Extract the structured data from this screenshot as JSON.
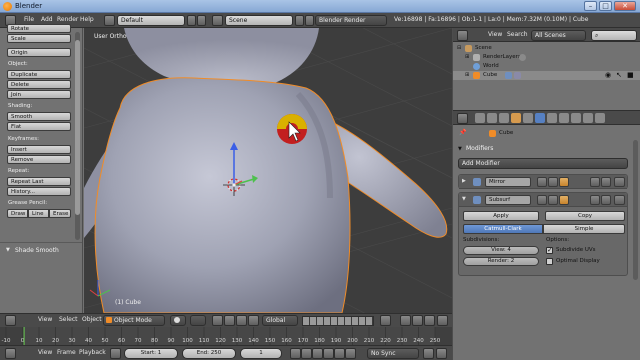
{
  "window": {
    "title": "Blender",
    "minimize": "–",
    "maximize": "□",
    "close": "✕"
  },
  "info_header": {
    "menus": [
      "File",
      "Add",
      "Render",
      "Help"
    ],
    "screen_layout": "Default",
    "scene": "Scene",
    "render_engine": "Blender Render",
    "stats": "Ve:16898 | Fa:16896 | Ob:1-1 | La:0 | Mem:7.32M (0.10M) | Cube"
  },
  "toolshelf": {
    "top_items": [
      "Rotate",
      "Scale"
    ],
    "origin": "Origin",
    "object_label": "Object:",
    "object_items": [
      "Duplicate",
      "Delete",
      "Join"
    ],
    "shading_label": "Shading:",
    "shading_items": [
      "Smooth",
      "Flat"
    ],
    "keyframes_label": "Keyframes:",
    "keyframe_items": [
      "Insert",
      "Remove"
    ],
    "repeat_label": "Repeat:",
    "repeat_items": [
      "Repeat Last",
      "History..."
    ],
    "grease_label": "Grease Pencil:",
    "grease_items": [
      "Draw",
      "Line",
      "Erase"
    ],
    "operator_panel": "Shade Smooth"
  },
  "viewport": {
    "view_label": "User Ortho",
    "object_label": "(1) Cube"
  },
  "viewport_header": {
    "menus": [
      "View",
      "Select",
      "Object"
    ],
    "mode": "Object Mode",
    "orientation": "Global"
  },
  "timeline": {
    "ticks": [
      "-10",
      "0",
      "10",
      "20",
      "30",
      "40",
      "50",
      "60",
      "70",
      "80",
      "90",
      "100",
      "110",
      "120",
      "130",
      "140",
      "150",
      "160",
      "170",
      "180",
      "190",
      "200",
      "210",
      "220",
      "230",
      "240",
      "250"
    ],
    "menus": [
      "View",
      "Frame",
      "Playback"
    ],
    "start": "Start: 1",
    "end": "End: 250",
    "current": "1",
    "sync": "No Sync"
  },
  "outliner": {
    "menus": [
      "View",
      "Search"
    ],
    "filter": "All Scenes",
    "items": [
      "Scene",
      "RenderLayers",
      "World",
      "Cube"
    ]
  },
  "properties": {
    "breadcrumb": "Cube",
    "panel_title": "Modifiers",
    "add_modifier": "Add Modifier",
    "mirror_name": "Mirror",
    "subsurf_name": "Subsurf",
    "apply": "Apply",
    "copy": "Copy",
    "tab_catmull": "Catmull-Clark",
    "tab_simple": "Simple",
    "subdivisions_label": "Subdivisions:",
    "view_levels": "View: 4",
    "render_levels": "Render: 2",
    "options_label": "Options:",
    "subdivide_uvs": "Subdivide UVs",
    "optimal_display": "Optimal Display",
    "subdivide_uvs_checked": true,
    "optimal_display_checked": false
  },
  "colors": {
    "accent_blue": "#5680c2",
    "selection_orange": "#f08c28",
    "viewport_bg": "#3d3d3d",
    "panel_bg": "#727272"
  }
}
